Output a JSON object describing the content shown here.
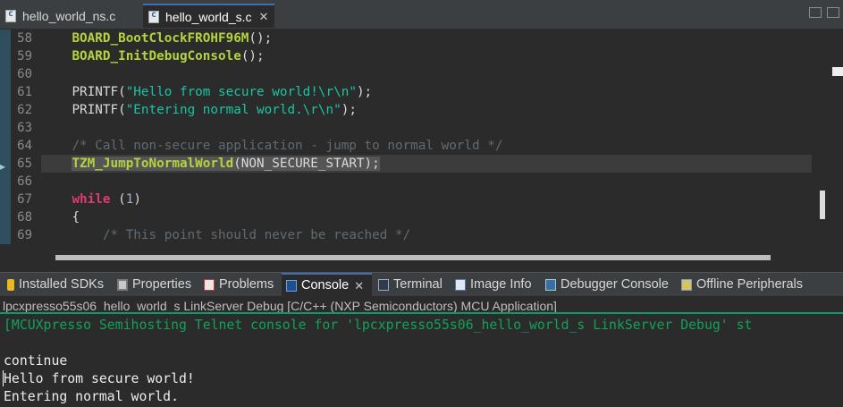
{
  "editor_tabs": [
    {
      "label": "hello_world_ns.c",
      "icon": "c-file-icon",
      "active": false
    },
    {
      "label": "hello_world_s.c",
      "icon": "c-file-icon",
      "active": true,
      "close": "✕"
    }
  ],
  "code_lines": [
    {
      "n": "58",
      "text": "BOARD_BootClockFROHF96M();"
    },
    {
      "n": "59",
      "text": "BOARD_InitDebugConsole();"
    },
    {
      "n": "60",
      "text": ""
    },
    {
      "n": "61",
      "text": "PRINTF(\"Hello from secure world!\\r\\n\");"
    },
    {
      "n": "62",
      "text": "PRINTF(\"Entering normal world.\\r\\n\");"
    },
    {
      "n": "63",
      "text": ""
    },
    {
      "n": "64",
      "text": "/* Call non-secure application - jump to normal world */"
    },
    {
      "n": "65",
      "text": "TZM_JumpToNormalWorld(NON_SECURE_START);"
    },
    {
      "n": "66",
      "text": ""
    },
    {
      "n": "67",
      "text": "while (1)"
    },
    {
      "n": "68",
      "text": "{"
    },
    {
      "n": "69",
      "text": "/* This point should never be reached */"
    }
  ],
  "code": {
    "l58_fn": "BOARD_BootClockFROHF96M",
    "l58_rest": "();",
    "l59_fn": "BOARD_InitDebugConsole",
    "l59_rest": "();",
    "l61_a": "PRINTF(",
    "l61_str": "\"Hello from secure world!\\r\\n\"",
    "l61_b": ");",
    "l62_a": "PRINTF(",
    "l62_str": "\"Entering normal world.\\r\\n\"",
    "l62_b": ");",
    "l64_cm": "/* Call non-secure application - jump to normal world */",
    "l65_fn": "TZM_JumpToNormalWorld",
    "l65_rest": "(NON_SECURE_START);",
    "l67_kw": "while",
    "l67_a": " (",
    "l67_num": "1",
    "l67_b": ")",
    "l68": "{",
    "l69_cm": "/* This point should never be reached */"
  },
  "view_tabs": [
    {
      "label": "Installed SDKs",
      "icon": "sdk-icon"
    },
    {
      "label": "Properties",
      "icon": "properties-icon"
    },
    {
      "label": "Problems",
      "icon": "problems-icon"
    },
    {
      "label": "Console",
      "icon": "console-icon",
      "active": true,
      "close": "✕"
    },
    {
      "label": "Terminal",
      "icon": "terminal-icon"
    },
    {
      "label": "Image Info",
      "icon": "image-info-icon"
    },
    {
      "label": "Debugger Console",
      "icon": "debugger-console-icon"
    },
    {
      "label": "Offline Peripherals",
      "icon": "offline-peripherals-icon"
    }
  ],
  "console_description": "lpcxpresso55s06_hello_world_s LinkServer Debug [C/C++ (NXP Semiconductors) MCU Application]",
  "console_lines": [
    "[MCUXpresso Semihosting Telnet console for 'lpcxpresso55s06_hello_world_s LinkServer Debug' st",
    "",
    "continue",
    "Hello from secure world!",
    "Entering normal world."
  ],
  "colors": {
    "editor_bg": "#2b2b2b",
    "function": "#b4d43e",
    "string": "#17c6a3",
    "keyword": "#e03a74",
    "comment": "#5f6b73",
    "console_green": "#12a15a",
    "active_tab_accent": "#3c6fb5"
  }
}
